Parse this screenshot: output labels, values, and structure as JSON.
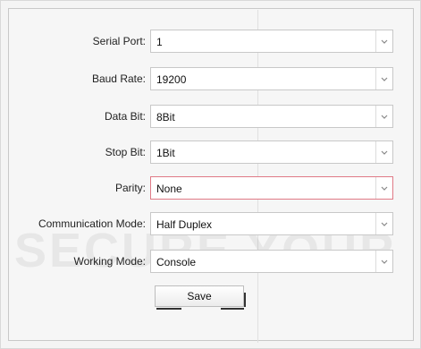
{
  "form": {
    "fields": [
      {
        "label": "Serial Port:",
        "value": "1"
      },
      {
        "label": "Baud Rate:",
        "value": "19200"
      },
      {
        "label": "Data Bit:",
        "value": "8Bit"
      },
      {
        "label": "Stop Bit:",
        "value": "1Bit"
      },
      {
        "label": "Parity:",
        "value": "None"
      },
      {
        "label": "Communication Mode:",
        "value": "Half Duplex"
      },
      {
        "label": "Working Mode:",
        "value": "Console"
      }
    ],
    "save_label": "Save"
  },
  "icons": {
    "dropdown": "chevron-down-icon"
  },
  "colors": {
    "background": "#f4f4f4",
    "field_border": "#c8c8c8",
    "highlight_border": "#e07a86"
  }
}
